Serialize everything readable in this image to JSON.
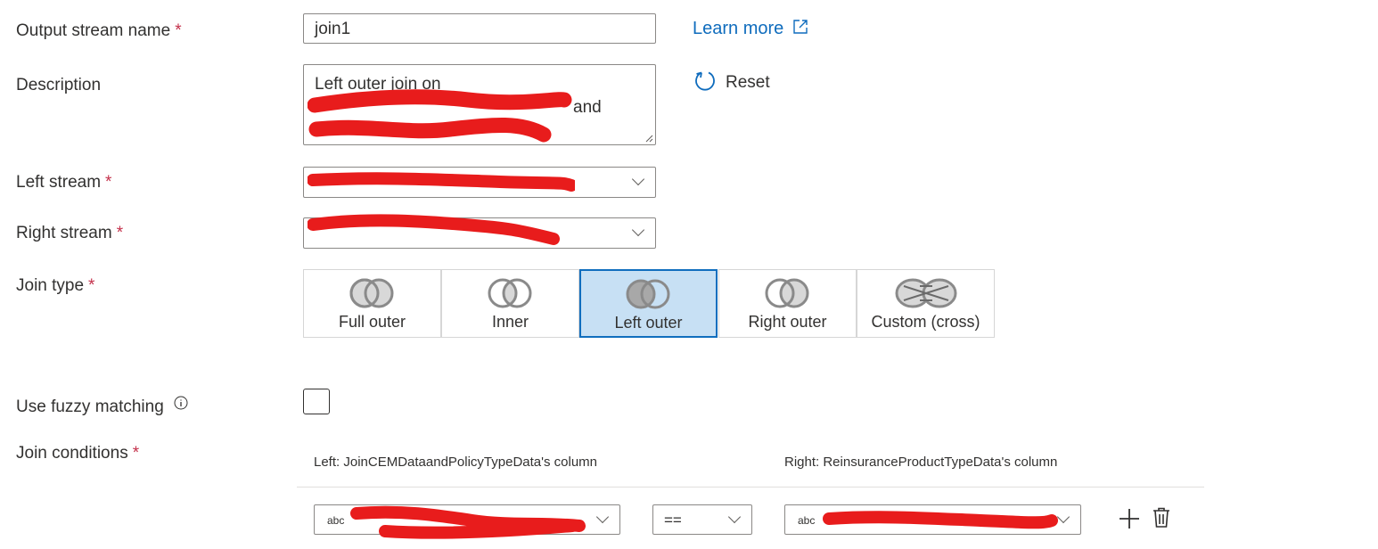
{
  "form": {
    "output_stream_name": {
      "label": "Output stream name",
      "value": "join1",
      "required": "*"
    },
    "learn_more": "Learn more",
    "description": {
      "label": "Description",
      "value_line1": "Left outer join on",
      "value_line2_tail": "and"
    },
    "reset": "Reset",
    "left_stream": {
      "label": "Left stream",
      "required": "*"
    },
    "right_stream": {
      "label": "Right stream",
      "required": "*"
    },
    "join_type": {
      "label": "Join type",
      "required": "*",
      "options": [
        "Full outer",
        "Inner",
        "Left outer",
        "Right outer",
        "Custom (cross)"
      ],
      "selected": "Left outer"
    },
    "fuzzy": {
      "label": "Use fuzzy matching",
      "checked": false
    },
    "join_conditions": {
      "label": "Join conditions",
      "required": "*",
      "left_header": "Left: JoinCEMDataandPolicyTypeData's column",
      "right_header": "Right: ReinsuranceProductTypeData's column",
      "row": {
        "left_type": "abc",
        "operator": "==",
        "right_type": "abc"
      }
    }
  },
  "colors": {
    "accent": "#0f6cbd",
    "redaction": "#e81c1c",
    "selected_bg": "#c7e0f4"
  }
}
